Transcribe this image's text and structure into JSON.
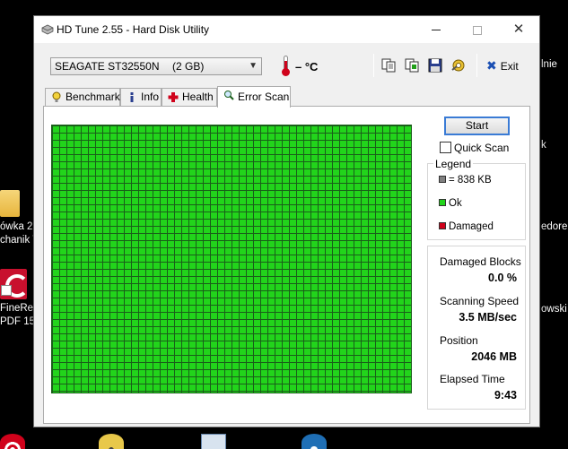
{
  "desktop": {
    "right_texts": [
      "lnie",
      "k",
      "edore",
      "owski"
    ],
    "left_texts": [
      "ówka 2",
      "chanik T",
      "FineRe",
      "PDF 15"
    ]
  },
  "window": {
    "title": "HD Tune 2.55 - Hard Disk Utility",
    "controls": {
      "minimize": "minimize-icon",
      "maximize": "maximize-icon",
      "close": "close-icon",
      "close_glyph": "✕"
    }
  },
  "toolbar": {
    "drive_model": "SEAGATE ST32550N",
    "drive_size": "(2 GB)",
    "temperature": "– °C",
    "tools": [
      "copy-icon",
      "copy-all-icon",
      "save-icon",
      "options-icon"
    ],
    "exit_label": "Exit"
  },
  "tabs": [
    {
      "label": "Benchmark",
      "icon": "benchmark-icon"
    },
    {
      "label": "Info",
      "icon": "info-icon"
    },
    {
      "label": "Health",
      "icon": "health-icon"
    },
    {
      "label": "Error Scan",
      "icon": "error-scan-icon",
      "active": true
    }
  ],
  "error_scan": {
    "start_label": "Start",
    "quick_scan_label": "Quick Scan",
    "quick_scan_checked": false,
    "legend": {
      "title": "Legend",
      "items": [
        {
          "label": "= 838 KB",
          "color": "#808080"
        },
        {
          "label": "Ok",
          "color": "#22d41b"
        },
        {
          "label": "Damaged",
          "color": "#d0021b"
        }
      ]
    },
    "grid_color": "#22d41b",
    "stats": {
      "damaged_blocks_label": "Damaged Blocks",
      "damaged_blocks_value": "0.0 %",
      "scanning_speed_label": "Scanning Speed",
      "scanning_speed_value": "3.5 MB/sec",
      "position_label": "Position",
      "position_value": "2046 MB",
      "elapsed_time_label": "Elapsed Time",
      "elapsed_time_value": "9:43"
    }
  }
}
